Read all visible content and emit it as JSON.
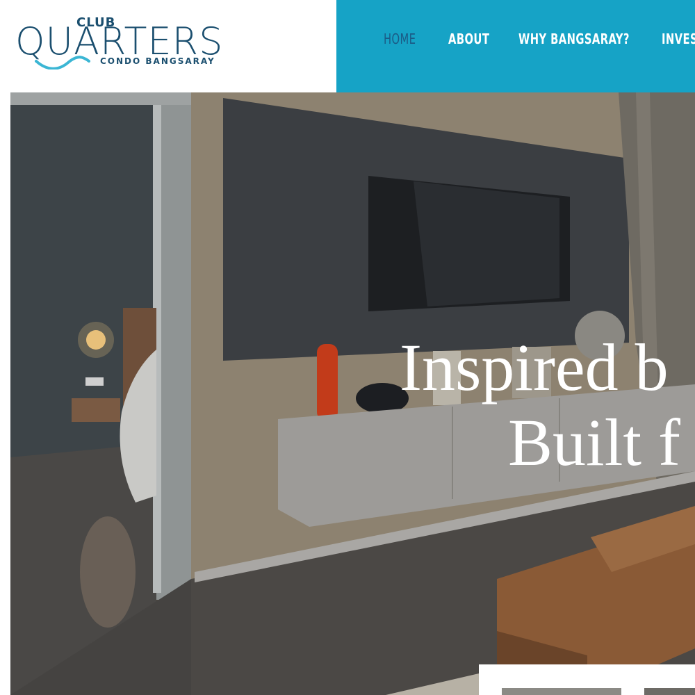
{
  "logo": {
    "club": "CLUB",
    "quarters": "QUARTERS",
    "sub": "CONDO BANGSARAY"
  },
  "nav": {
    "items": [
      {
        "label": "HOME",
        "active": true
      },
      {
        "label": "ABOUT",
        "active": false
      },
      {
        "label": "WHY BANGSARAY?",
        "active": false
      },
      {
        "label": "INVES",
        "active": false
      }
    ]
  },
  "hero": {
    "line1": "Inspired b",
    "line2": "Built f"
  },
  "colors": {
    "nav_bg": "#16a3c6",
    "logo": "#1b4f6f",
    "active_nav": "#1b5b86"
  }
}
